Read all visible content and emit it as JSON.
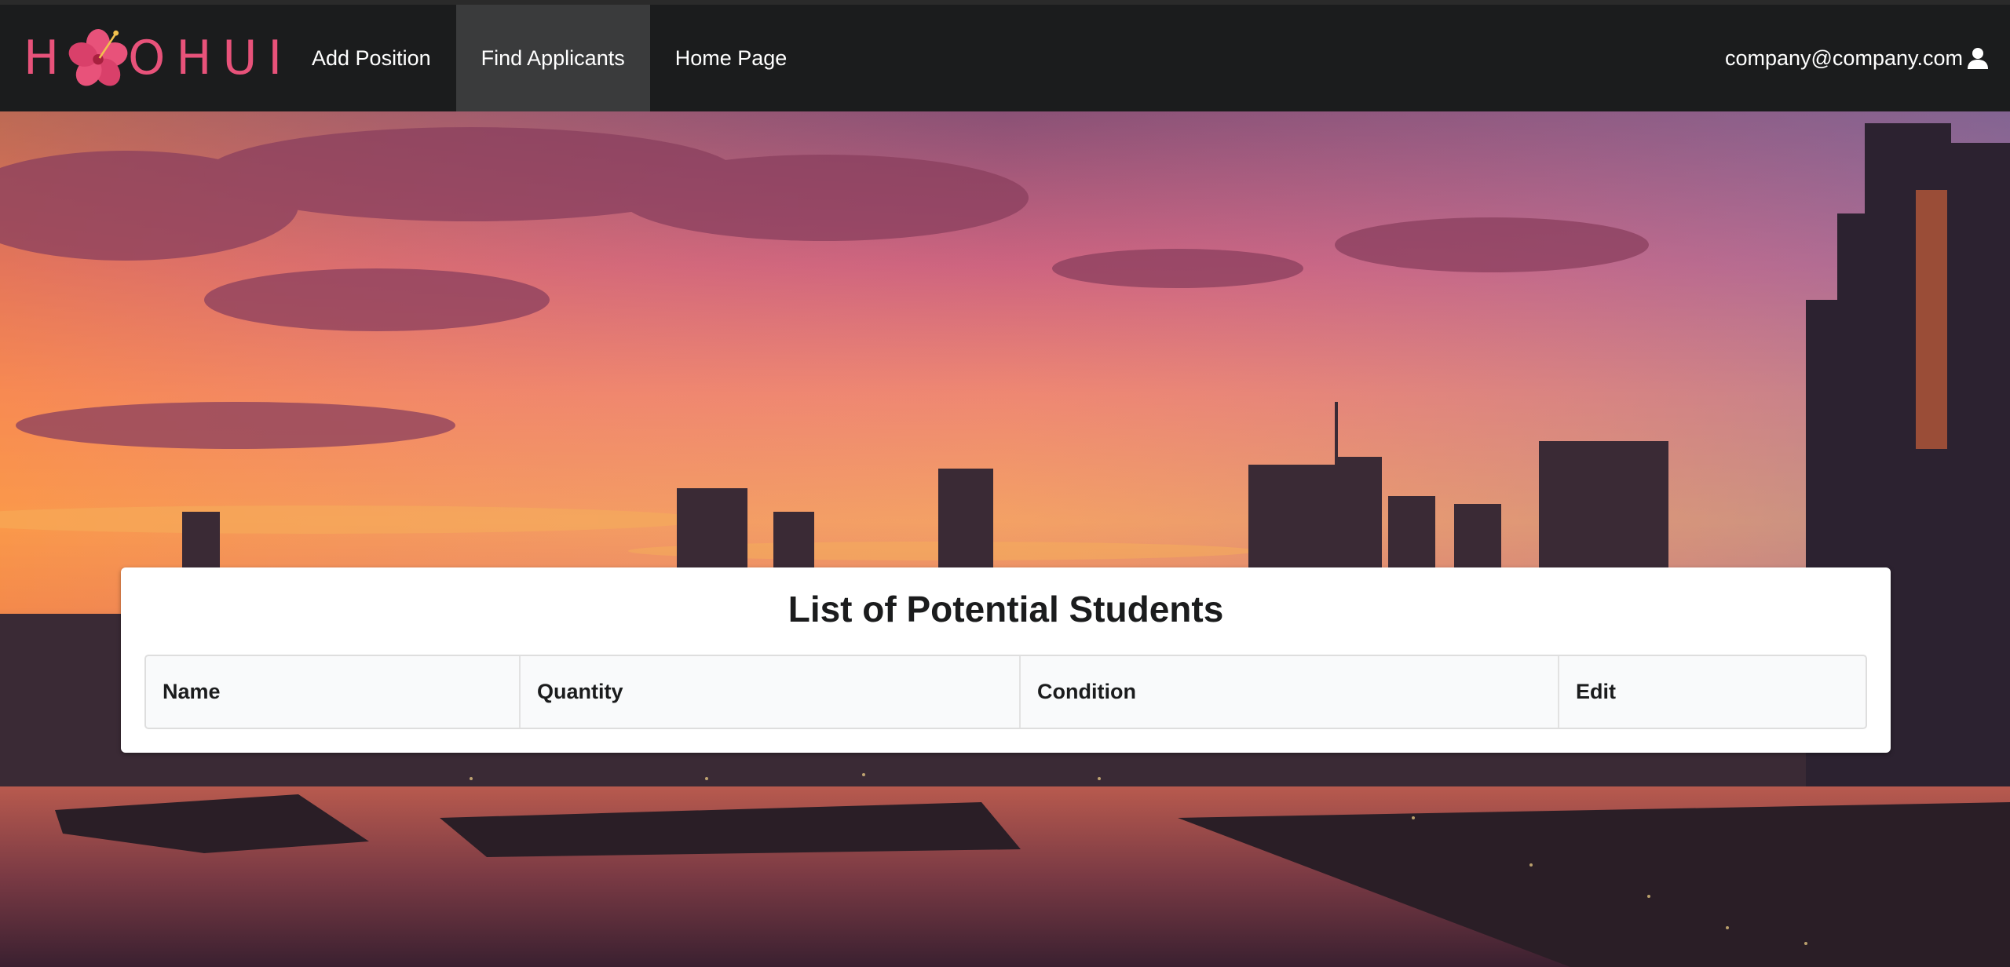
{
  "brand": {
    "logo_text_left": "H",
    "logo_text_right": "OHUI",
    "logo_color": "#e8527a"
  },
  "nav": {
    "items": [
      {
        "label": "Add Position",
        "active": false
      },
      {
        "label": "Find Applicants",
        "active": true
      },
      {
        "label": "Home Page",
        "active": false
      }
    ],
    "user_email": "company@company.com",
    "user_icon": "user-icon"
  },
  "background": {
    "description_icon": "city-sunset-image"
  },
  "main": {
    "title": "List of Potential Students",
    "table": {
      "headers": [
        "Name",
        "Quantity",
        "Condition",
        "Edit"
      ],
      "rows": []
    }
  },
  "colors": {
    "navbar_bg": "#1b1c1d",
    "active_item_bg": "#3a3b3c",
    "card_bg": "#ffffff",
    "table_header_bg": "#f9fafb"
  }
}
